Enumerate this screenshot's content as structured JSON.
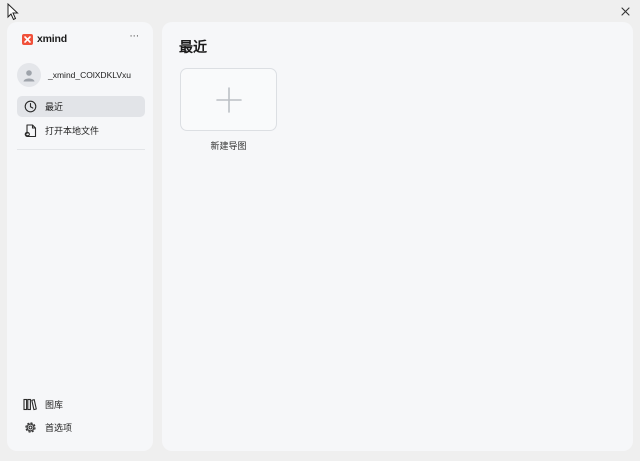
{
  "app": {
    "brand_name": "xmind"
  },
  "account": {
    "name": "_xmind_COlXDKLVxu"
  },
  "sidebar": {
    "more_label": "···",
    "nav": [
      {
        "label": "最近",
        "icon": "clock-icon",
        "active": true
      },
      {
        "label": "打开本地文件",
        "icon": "open-file-icon",
        "active": false
      }
    ],
    "bottom": [
      {
        "label": "图库",
        "icon": "library-icon"
      },
      {
        "label": "首选项",
        "icon": "gear-icon"
      }
    ]
  },
  "main": {
    "title": "最近",
    "new_card": {
      "label": "新建导图",
      "icon": "plus-icon"
    }
  },
  "colors": {
    "brand": "#f0513b",
    "active_bg": "#e2e4e8",
    "panel_bg": "#f6f7f9",
    "window_bg": "#efefef"
  }
}
